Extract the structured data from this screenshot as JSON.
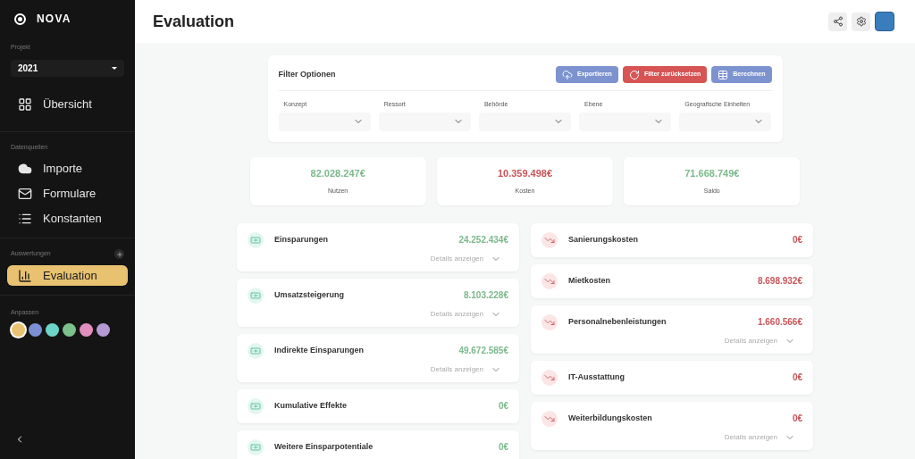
{
  "sidebar": {
    "brand": "NOVA",
    "project_label": "Projekt",
    "project_value": "2021",
    "items": [
      {
        "label": "Übersicht",
        "selected": false
      }
    ],
    "sections": [
      {
        "title": "Datenquellen",
        "add": false,
        "items": [
          {
            "label": "Importe",
            "selected": false
          },
          {
            "label": "Formulare",
            "selected": false
          },
          {
            "label": "Konstanten",
            "selected": false
          }
        ]
      },
      {
        "title": "Auswertungen",
        "add": true,
        "items": [
          {
            "label": "Evaluation",
            "selected": true
          }
        ]
      }
    ],
    "customize_label": "Anpassen",
    "swatches": [
      {
        "color": "#e8c270",
        "selected": true
      },
      {
        "color": "#7c8fd4",
        "selected": false
      },
      {
        "color": "#6dd4c8",
        "selected": false
      },
      {
        "color": "#7cc08c",
        "selected": false
      },
      {
        "color": "#e08fbf",
        "selected": false
      },
      {
        "color": "#b49ad4",
        "selected": false
      }
    ]
  },
  "header": {
    "title": "Evaluation"
  },
  "filter": {
    "title": "Filter Optionen",
    "buttons": [
      {
        "label": "Exportieren",
        "kind": "export"
      },
      {
        "label": "Filter zurücksetzen",
        "kind": "reset"
      },
      {
        "label": "Berechnen",
        "kind": "calc"
      }
    ],
    "fields": [
      {
        "label": "Konzept"
      },
      {
        "label": "Ressort"
      },
      {
        "label": "Behörde"
      },
      {
        "label": "Ebene"
      },
      {
        "label": "Geografische Einheiten"
      }
    ]
  },
  "summary": [
    {
      "value": "82.028.247€",
      "label": "Nutzen",
      "kind": "gain"
    },
    {
      "value": "10.359.498€",
      "label": "Kosten",
      "kind": "loss"
    },
    {
      "value": "71.668.749€",
      "label": "Saldo",
      "kind": "gain"
    }
  ],
  "benefits": [
    {
      "label": "Einsparungen",
      "value": "24.252.434€",
      "details": "Details anzeigen"
    },
    {
      "label": "Umsatzsteigerung",
      "value": "8.103.228€",
      "details": "Details anzeigen"
    },
    {
      "label": "Indirekte Einsparungen",
      "value": "49.672.585€",
      "details": "Details anzeigen"
    },
    {
      "label": "Kumulative Effekte",
      "value": "0€"
    },
    {
      "label": "Weitere Einsparpotentiale",
      "value": "0€"
    }
  ],
  "costs": [
    {
      "label": "Sanierungskosten",
      "value": "0€"
    },
    {
      "label": "Mietkosten",
      "value": "8.698.932€"
    },
    {
      "label": "Personalnebenleistungen",
      "value": "1.660.566€",
      "details": "Details anzeigen"
    },
    {
      "label": "IT-Ausstattung",
      "value": "0€"
    },
    {
      "label": "Weiterbildungskosten",
      "value": "0€",
      "details": "Details anzeigen"
    }
  ]
}
